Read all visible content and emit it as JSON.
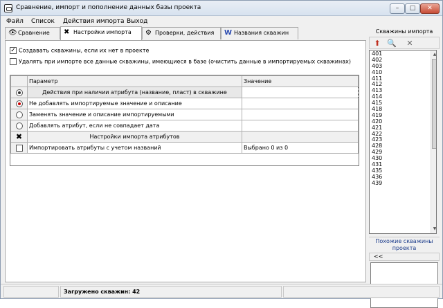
{
  "window": {
    "title": "Сравнение, импорт и пополнение данных базы проекта",
    "minimize_glyph": "–",
    "maximize_glyph": "□",
    "close_glyph": "✕"
  },
  "menu": [
    "Файл",
    "Список",
    "Действия импорта",
    "Выход"
  ],
  "tabs": [
    {
      "label": "Сравнение",
      "icon": "eye-icon"
    },
    {
      "label": "Настройки импорта",
      "icon": "tools-icon"
    },
    {
      "label": "Проверки, действия",
      "icon": "gear-icon"
    },
    {
      "label": "Названия скважин",
      "icon": "word-icon"
    }
  ],
  "options": {
    "create_wells": {
      "label": "Создавать скважины, если их нет в проекте",
      "checked": true
    },
    "delete_data": {
      "label": "Удалять при импорте все данные скважины, имеющиеся в базе (очистить данные в импортируемых скважинах)",
      "checked": false
    }
  },
  "grid": {
    "headers": [
      "Параметр",
      "Значение"
    ],
    "rows": [
      {
        "param": "Действия при наличии атрибута (название, пласт) в скважине",
        "value": "",
        "marker": "radio-header"
      },
      {
        "param": "Не добавлять импортируемые значение и описание",
        "value": "",
        "marker": "radio-on"
      },
      {
        "param": "Заменять значение и описание импортируемыми",
        "value": "",
        "marker": "radio-off"
      },
      {
        "param": "Добавлять атрибут, если не совпадает дата",
        "value": "",
        "marker": "radio-off"
      },
      {
        "param": "Настройки импорта атрибутов",
        "value": "",
        "marker": "tools"
      },
      {
        "param": "Импортировать атрибуты с учетом названий",
        "value": "Выбрано 0 из 0",
        "marker": "checkbox"
      }
    ]
  },
  "right_panel": {
    "title": "Скважины импорта",
    "wells": [
      "401",
      "402",
      "403",
      "410",
      "411",
      "412",
      "413",
      "414",
      "415",
      "418",
      "419",
      "420",
      "421",
      "422",
      "423",
      "428",
      "429",
      "430",
      "431",
      "435",
      "436",
      "439"
    ],
    "similar_label": "Похожие скважины проекта",
    "back_label": "<<"
  },
  "status": {
    "loaded": "Загружено скважин: 42"
  }
}
